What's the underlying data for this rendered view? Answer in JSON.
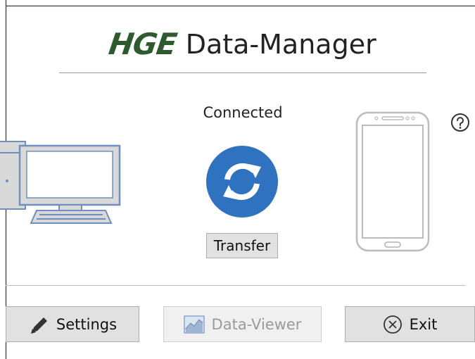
{
  "header": {
    "logo_text": "HGE",
    "app_name": "Data-Manager"
  },
  "status": {
    "text": "Connected"
  },
  "transfer": {
    "label": "Transfer"
  },
  "buttons": {
    "settings": "Settings",
    "data_viewer": "Data-Viewer",
    "exit": "Exit"
  },
  "icons": {
    "sync": "sync-icon",
    "help": "help-icon",
    "computer": "computer-icon",
    "phone": "phone-icon",
    "settings": "pencil-icon",
    "data_viewer": "chart-icon",
    "exit": "close-circle-icon"
  },
  "colors": {
    "logo": "#2e5a30",
    "sync_blue": "#2f72bf",
    "computer_outline": "#6f8fbf"
  }
}
